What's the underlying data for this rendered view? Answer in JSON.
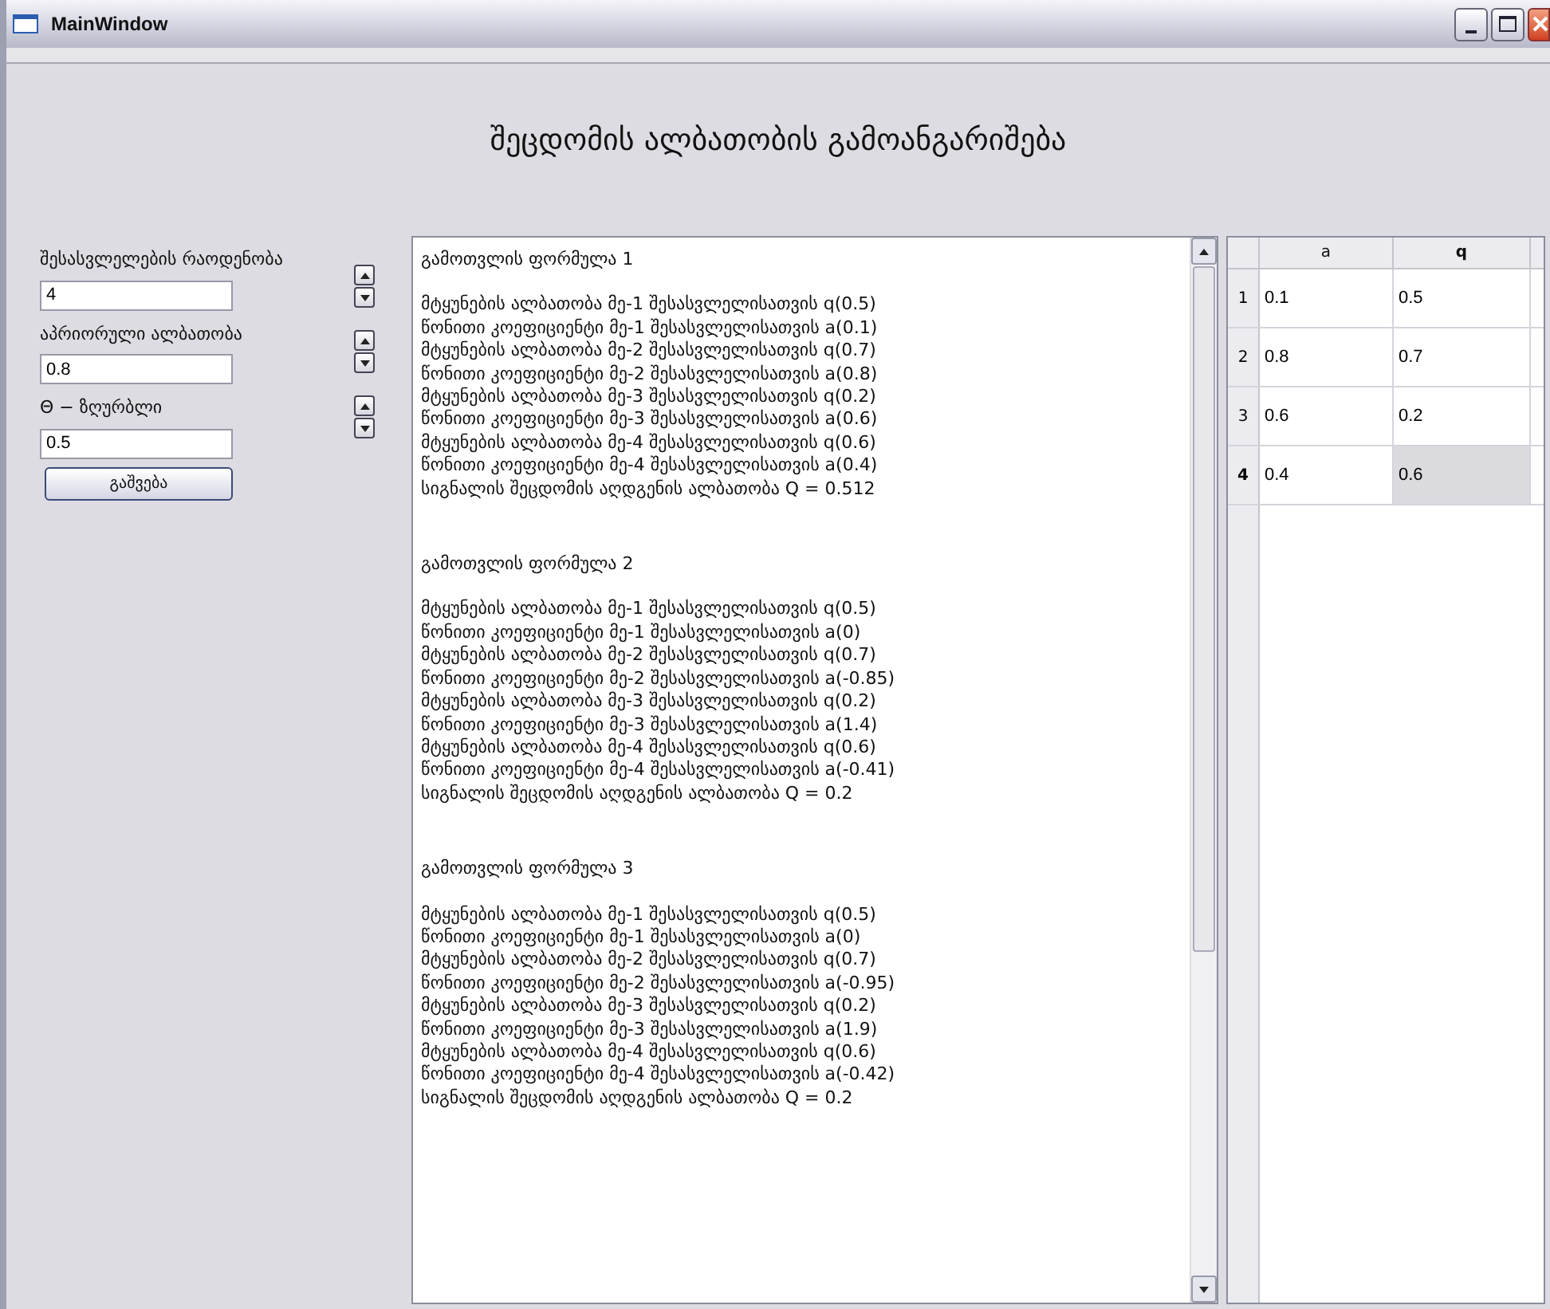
{
  "window": {
    "title": "MainWindow"
  },
  "heading": "შეცდომის ალბათობის გამოანგარიშება",
  "inputs": [
    {
      "label": "შესასვლელების რაოდენობა",
      "value": "4"
    },
    {
      "label": "აპრიორული ალბათობა",
      "value": "0.8"
    },
    {
      "label": "Θ − ზღურბლი",
      "value": "0.5"
    }
  ],
  "run_button": "გაშვება",
  "output": [
    {
      "heading": "გამოთვლის ფორმულა 1",
      "lines": [
        "მტყუნების ალბათობა მე-1 შესასვლელისათვის q(0.5)",
        "წონითი კოეფიციენტი მე-1 შესასვლელისათვის a(0.1)",
        "მტყუნების ალბათობა მე-2 შესასვლელისათვის q(0.7)",
        "წონითი კოეფიციენტი მე-2 შესასვლელისათვის a(0.8)",
        "მტყუნების ალბათობა მე-3 შესასვლელისათვის q(0.2)",
        "წონითი კოეფიციენტი მე-3 შესასვლელისათვის a(0.6)",
        "მტყუნების ალბათობა მე-4 შესასვლელისათვის q(0.6)",
        "წონითი კოეფიციენტი მე-4 შესასვლელისათვის a(0.4)",
        "სიგნალის შეცდომის აღდგენის ალბათობა Q = 0.512"
      ]
    },
    {
      "heading": "გამოთვლის ფორმულა 2",
      "lines": [
        "მტყუნების ალბათობა მე-1 შესასვლელისათვის q(0.5)",
        "წონითი კოეფიციენტი მე-1 შესასვლელისათვის a(0)",
        "მტყუნების ალბათობა მე-2 შესასვლელისათვის q(0.7)",
        "წონითი კოეფიციენტი მე-2 შესასვლელისათვის a(-0.85)",
        "მტყუნების ალბათობა მე-3 შესასვლელისათვის q(0.2)",
        "წონითი კოეფიციენტი მე-3 შესასვლელისათვის a(1.4)",
        "მტყუნების ალბათობა მე-4 შესასვლელისათვის q(0.6)",
        "წონითი კოეფიციენტი მე-4 შესასვლელისათვის a(-0.41)",
        "სიგნალის შეცდომის აღდგენის ალბათობა Q = 0.2"
      ]
    },
    {
      "heading": "გამოთვლის ფორმულა 3",
      "lines": [
        "მტყუნების ალბათობა მე-1 შესასვლელისათვის q(0.5)",
        "წონითი კოეფიციენტი მე-1 შესასვლელისათვის a(0)",
        "მტყუნების ალბათობა მე-2 შესასვლელისათვის q(0.7)",
        "წონითი კოეფიციენტი მე-2 შესასვლელისათვის a(-0.95)",
        "მტყუნების ალბათობა მე-3 შესასვლელისათვის q(0.2)",
        "წონითი კოეფიციენტი მე-3 შესასვლელისათვის a(1.9)",
        "მტყუნების ალბათობა მე-4 შესასვლელისათვის q(0.6)",
        "წონითი კოეფიციენტი მე-4 შესასვლელისათვის a(-0.42)",
        "სიგნალის შეცდომის აღდგენის ალბათობა Q = 0.2"
      ]
    }
  ],
  "table": {
    "columns": [
      "a",
      "q"
    ],
    "rows": [
      {
        "index": "1",
        "current": false,
        "cells": [
          {
            "text": "0.1",
            "selected": false
          },
          {
            "text": "0.5",
            "selected": false
          }
        ]
      },
      {
        "index": "2",
        "current": false,
        "cells": [
          {
            "text": "0.8",
            "selected": false
          },
          {
            "text": "0.7",
            "selected": false
          }
        ]
      },
      {
        "index": "3",
        "current": false,
        "cells": [
          {
            "text": "0.6",
            "selected": false
          },
          {
            "text": "0.2",
            "selected": false
          }
        ]
      },
      {
        "index": "4",
        "current": true,
        "cells": [
          {
            "text": "0.4",
            "selected": false
          },
          {
            "text": "0.6",
            "selected": true
          }
        ]
      }
    ]
  }
}
